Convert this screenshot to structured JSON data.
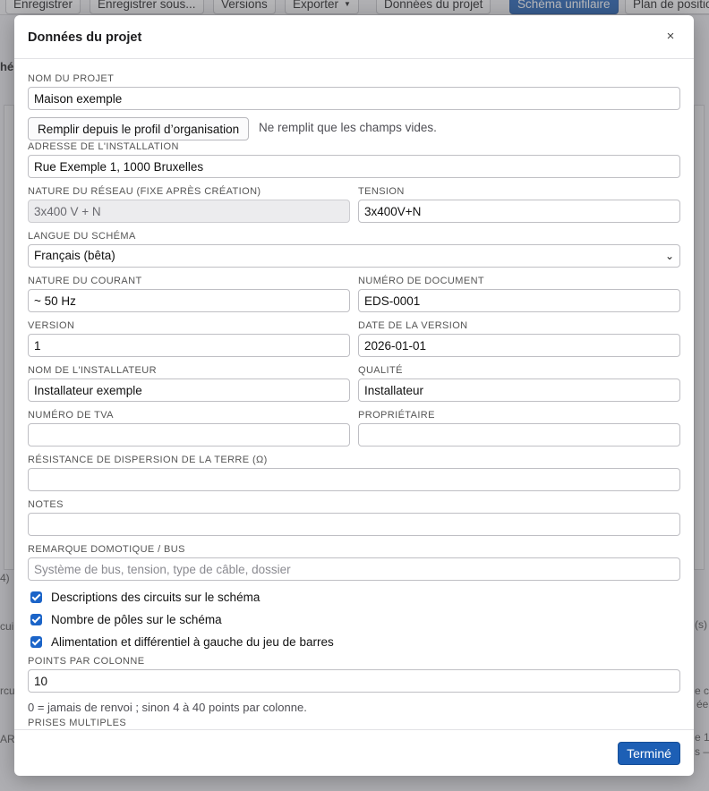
{
  "toolbar": {
    "buttons": [
      {
        "label": "Enregistrer"
      },
      {
        "label": "Enregistrer sous..."
      },
      {
        "label": "Versions"
      },
      {
        "label": "Exporter"
      },
      {
        "label": "Données du projet"
      },
      {
        "label": "Schéma unifilaire"
      },
      {
        "label": "Plan de positio"
      }
    ]
  },
  "background": {
    "fragments": [
      "hé",
      "4)",
      "cui",
      "(s)",
      "rcu",
      "e c",
      "ée",
      "AR",
      "e 1",
      "s –"
    ]
  },
  "modal": {
    "title": "Données du projet",
    "close_glyph": "×",
    "fill_button": "Remplir depuis le profil d’organisation",
    "fill_hint": "Ne remplit que les champs vides.",
    "fields": {
      "project_name": {
        "label": "NOM DU PROJET",
        "value": "Maison exemple"
      },
      "install_address": {
        "label": "ADRESSE DE L'INSTALLATION",
        "value": "Rue Exemple 1, 1000 Bruxelles"
      },
      "network_type": {
        "label": "NATURE DU RÉSEAU (FIXE APRÈS CRÉATION)",
        "value": "3x400 V + N"
      },
      "voltage": {
        "label": "TENSION",
        "value": "3x400V+N"
      },
      "schema_language": {
        "label": "LANGUE DU SCHÉMA",
        "value": "Français (bêta)"
      },
      "current_type": {
        "label": "NATURE DU COURANT",
        "value": "~ 50 Hz"
      },
      "document_number": {
        "label": "NUMÉRO DE DOCUMENT",
        "value": "EDS-0001"
      },
      "version": {
        "label": "VERSION",
        "value": "1"
      },
      "version_date": {
        "label": "DATE DE LA VERSION",
        "value": "2026-01-01"
      },
      "installer_name": {
        "label": "NOM DE L'INSTALLATEUR",
        "value": "Installateur exemple"
      },
      "quality": {
        "label": "QUALITÉ",
        "value": "Installateur"
      },
      "vat_number": {
        "label": "NUMÉRO DE TVA",
        "value": ""
      },
      "owner": {
        "label": "PROPRIÉTAIRE",
        "value": ""
      },
      "earth_resistance": {
        "label": "RÉSISTANCE DE DISPERSION DE LA TERRE (Ω)",
        "value": ""
      },
      "notes": {
        "label": "NOTES",
        "value": ""
      },
      "bus_remark": {
        "label": "REMARQUE DOMOTIQUE / BUS",
        "value": "",
        "placeholder": "Système de bus, tension, type de câble, dossier"
      },
      "points_per_column": {
        "label": "POINTS PAR COLONNE",
        "value": "10",
        "hint": "0 = jamais de renvoi ; sinon 4 à 40 points par colonne."
      }
    },
    "checkboxes": [
      {
        "label": "Descriptions des circuits sur le schéma",
        "checked": true
      },
      {
        "label": "Nombre de pôles sur le schéma",
        "checked": true
      },
      {
        "label": "Alimentation et différentiel à gauche du jeu de barres",
        "checked": true
      }
    ],
    "multi_sockets_label": "PRISES MULTIPLES",
    "done_button": "Terminé"
  },
  "colors": {
    "primary": "#1d5fb5",
    "checkbox": "#1b64c8",
    "overlay": "rgba(90,90,96,0.42)"
  }
}
